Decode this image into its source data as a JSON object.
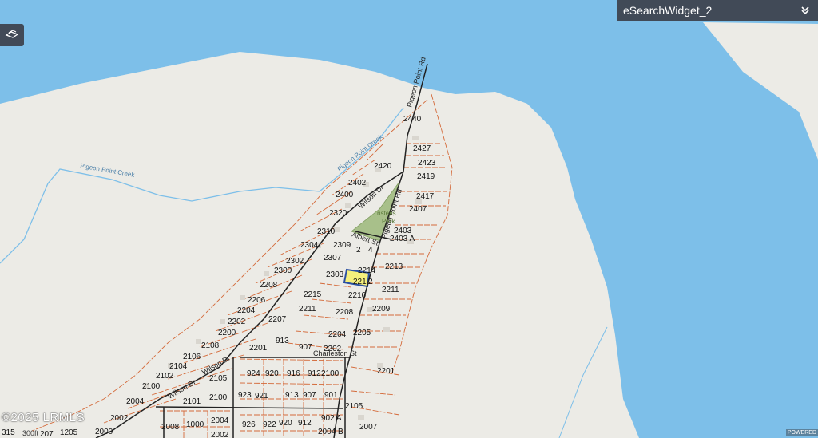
{
  "widget": {
    "title": "eSearchWidget_2"
  },
  "colors": {
    "water": "#7dbfe9",
    "land": "#ecebe6",
    "parcel": "#d46a3a",
    "road": "#222222",
    "park": "#a8c08a",
    "selected": "#2a4fa0",
    "selected_fill": "#f4ef7c"
  },
  "labels": {
    "creek_1": "Pigeon Point Creek",
    "creek_2": "Pigeon Point Creek",
    "road_pigeon_1": "Pigeon Point Rd",
    "road_pigeon_2": "Pigeon Point Rd",
    "road_wilson_1": "Wilson Dr",
    "road_wilson_2": "Wilson Dr",
    "road_wilson_3": "Wilson Dr",
    "road_albert": "Albert St",
    "road_charleston": "Charleston St",
    "park_1": "ristens",
    "park_2": "Park",
    "lot_2440": "2440",
    "lot_2427": "2427",
    "lot_2423": "2423",
    "lot_2420": "2420",
    "lot_2419": "2419",
    "lot_2402": "2402",
    "lot_2400": "2400",
    "lot_2417": "2417",
    "lot_2407": "2407",
    "lot_2320": "2320",
    "lot_2310": "2310",
    "lot_2403": "2403",
    "lot_2403a": "2403 A",
    "lot_2304": "2304",
    "lot_2309": "2309",
    "lot_2": "2",
    "lot_4": "4",
    "lot_2302": "2302",
    "lot_2307": "2307",
    "lot_2300": "2300",
    "lot_2213": "2213",
    "lot_2303": "2303",
    "lot_2214": "2214",
    "lot_221": "221",
    "lot_2208a": "2208",
    "lot_2211": "2211",
    "lot_2215": "2215",
    "lot_2210": "2210",
    "lot_2206": "2206",
    "lot_2204a": "2204",
    "lot_2211b": "2211",
    "lot_2209": "2209",
    "lot_2208b": "2208",
    "lot_2202a": "2202",
    "lot_2207": "2207",
    "lot_2200": "2200",
    "lot_2204b": "2204",
    "lot_2205": "2205",
    "lot_913a": "913",
    "lot_2108": "2108",
    "lot_2201a": "2201",
    "lot_907a": "907",
    "lot_2202b": "2202",
    "lot_2106": "2106",
    "lot_2104": "2104",
    "lot_924": "924",
    "lot_920a": "920",
    "lot_916": "916",
    "lot_912a": "912",
    "lot_2100a": "2100",
    "lot_2201b": "2201",
    "lot_2102": "2102",
    "lot_2105": "2105",
    "lot_2100b": "2100",
    "lot_923": "923",
    "lot_921": "921",
    "lot_913b": "913",
    "lot_907b": "907",
    "lot_901": "901",
    "lot_2004a": "2004",
    "lot_2101": "2101",
    "lot_2100c": "2100",
    "lot_2105b": "2105",
    "lot_2002a": "2002",
    "lot_2004b": "2004",
    "lot_902a": "902 A",
    "lot_2000": "2000",
    "lot_2008": "2008",
    "lot_1000": "1000",
    "lot_926": "926",
    "lot_922": "922",
    "lot_920b": "920",
    "lot_912b": "912",
    "lot_2007": "2007",
    "lot_2002b": "2002",
    "lot_2004c": "2004 B",
    "lot_1205": "1205",
    "lot_207": "207",
    "lot_315": "315"
  },
  "footer": {
    "copyright": "©2025 LRMLS",
    "scale": "300ft",
    "powered": "POWERED"
  }
}
